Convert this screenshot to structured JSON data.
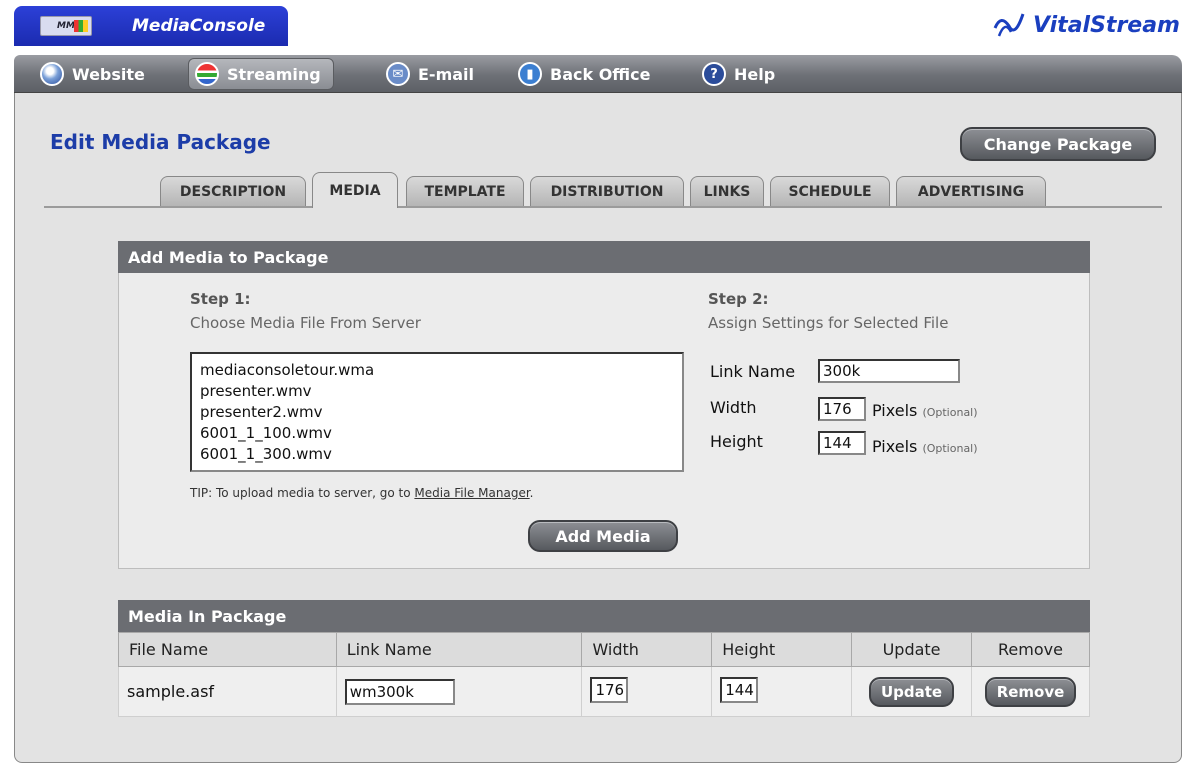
{
  "header": {
    "app_name": "MediaConsole",
    "logo_text": "MM",
    "brand": "VitalStream"
  },
  "nav": [
    {
      "label": "Website",
      "icon": "globe-icon"
    },
    {
      "label": "Streaming",
      "icon": "waves-icon",
      "active": true
    },
    {
      "label": "E-mail",
      "icon": "mail-icon"
    },
    {
      "label": "Back Office",
      "icon": "chart-icon"
    },
    {
      "label": "Help",
      "icon": "help-icon",
      "glyph": "?"
    }
  ],
  "page": {
    "title": "Edit Media Package",
    "change_package_label": "Change Package"
  },
  "tabs": [
    {
      "label": "DESCRIPTION"
    },
    {
      "label": "MEDIA",
      "active": true
    },
    {
      "label": "TEMPLATE"
    },
    {
      "label": "DISTRIBUTION"
    },
    {
      "label": "LINKS"
    },
    {
      "label": "SCHEDULE"
    },
    {
      "label": "ADVERTISING"
    }
  ],
  "add_media": {
    "title": "Add Media to Package",
    "step1_title": "Step 1:",
    "step1_sub": "Choose Media File From Server",
    "files": [
      "mediaconsoletour.wma",
      "presenter.wmv",
      "presenter2.wmv",
      "6001_1_100.wmv",
      "6001_1_300.wmv"
    ],
    "tip_prefix": "TIP: To upload media to server, go to ",
    "tip_link": "Media File Manager",
    "tip_suffix": ".",
    "add_button": "Add Media",
    "step2_title": "Step 2:",
    "step2_sub": "Assign Settings for Selected File",
    "link_name_label": "Link Name",
    "link_name_value": "300k",
    "width_label": "Width",
    "width_value": "176",
    "height_label": "Height",
    "height_value": "144",
    "pixels_label": "Pixels",
    "optional_label": "(Optional)"
  },
  "media_in_package": {
    "title": "Media In Package",
    "columns": [
      "File Name",
      "Link Name",
      "Width",
      "Height",
      "Update",
      "Remove"
    ],
    "rows": [
      {
        "file_name": "sample.asf",
        "link_name": "wm300k",
        "width": "176",
        "height": "144",
        "update": "Update",
        "remove": "Remove"
      }
    ]
  }
}
